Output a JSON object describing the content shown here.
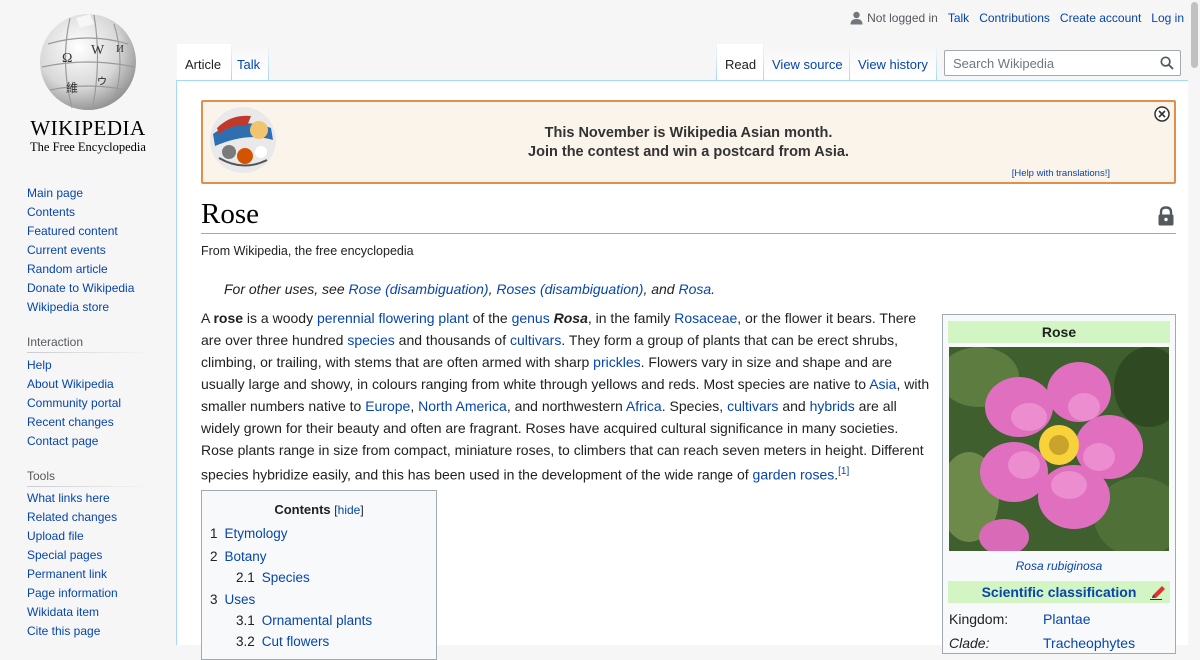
{
  "logo": {
    "wordmark": "Wikipedia",
    "tagline": "The Free Encyclopedia"
  },
  "personal": {
    "not_logged_in": "Not logged in",
    "talk": "Talk",
    "contributions": "Contributions",
    "create_account": "Create account",
    "log_in": "Log in"
  },
  "tabs": {
    "article": "Article",
    "talk": "Talk",
    "read": "Read",
    "view_source": "View source",
    "view_history": "View history"
  },
  "search": {
    "placeholder": "Search Wikipedia"
  },
  "sidebar": {
    "navigation": [
      "Main page",
      "Contents",
      "Featured content",
      "Current events",
      "Random article",
      "Donate to Wikipedia",
      "Wikipedia store"
    ],
    "interaction_heading": "Interaction",
    "interaction": [
      "Help",
      "About Wikipedia",
      "Community portal",
      "Recent changes",
      "Contact page"
    ],
    "tools_heading": "Tools",
    "tools": [
      "What links here",
      "Related changes",
      "Upload file",
      "Special pages",
      "Permanent link",
      "Page information",
      "Wikidata item",
      "Cite this page"
    ]
  },
  "banner": {
    "line1": "This November is Wikipedia Asian month.",
    "line2": "Join the contest and win a postcard from Asia.",
    "help": "[Help with translations!]"
  },
  "article": {
    "title": "Rose",
    "tagline": "From Wikipedia, the free encyclopedia",
    "hatnote": {
      "prefix": "For other uses, see ",
      "link1": "Rose (disambiguation)",
      "sep1": ", ",
      "link2": "Roses (disambiguation)",
      "sep2": ", and ",
      "link3": "Rosa",
      "end": "."
    },
    "para": {
      "t0": "A ",
      "b0": "rose",
      "t1": " is a woody ",
      "l1": "perennial",
      "t2": " ",
      "l2": "flowering plant",
      "t3": " of the ",
      "l3": "genus",
      "t4": " ",
      "bi0": "Rosa",
      "t5": ", in the family ",
      "l4": "Rosaceae",
      "t6": ", or the flower it bears. There are over three hundred ",
      "l5": "species",
      "t7": " and thousands of ",
      "l6": "cultivars",
      "t8": ". They form a group of plants that can be erect shrubs, climbing, or trailing, with stems that are often armed with sharp ",
      "l7": "prickles",
      "t9": ". Flowers vary in size and shape and are usually large and showy, in colours ranging from white through yellows and reds. Most species are native to ",
      "l8": "Asia",
      "t10": ", with smaller numbers native to ",
      "l9": "Europe",
      "t11": ", ",
      "l10": "North America",
      "t12": ", and northwestern ",
      "l11": "Africa",
      "t13": ". Species, ",
      "l12": "cultivars",
      "t14": " and ",
      "l13": "hybrids",
      "t15": " are all widely grown for their beauty and often are fragrant. Roses have acquired cultural significance in many societies. Rose plants range in size from compact, miniature roses, to climbers that can reach seven meters in height. Different species hybridize easily, and this has been used in the development of the wide range of ",
      "l14": "garden roses",
      "t16": ".",
      "ref": "[1]"
    }
  },
  "toc": {
    "heading": "Contents",
    "hide": "hide",
    "items": [
      {
        "num": "1",
        "label": "Etymology"
      },
      {
        "num": "2",
        "label": "Botany"
      },
      {
        "num": "2.1",
        "label": "Species"
      },
      {
        "num": "3",
        "label": "Uses"
      },
      {
        "num": "3.1",
        "label": "Ornamental plants"
      },
      {
        "num": "3.2",
        "label": "Cut flowers"
      }
    ]
  },
  "infobox": {
    "title": "Rose",
    "caption": "Rosa rubiginosa",
    "scientific_classification": "Scientific classification",
    "rows": [
      {
        "key": "Kingdom:",
        "value": "Plantae"
      },
      {
        "key": "Clade:",
        "value": "Tracheophytes"
      }
    ]
  },
  "colors": {
    "link": "#0645ad",
    "banner_border": "#e18f4d",
    "infobox_header": "#d3f5c3"
  }
}
